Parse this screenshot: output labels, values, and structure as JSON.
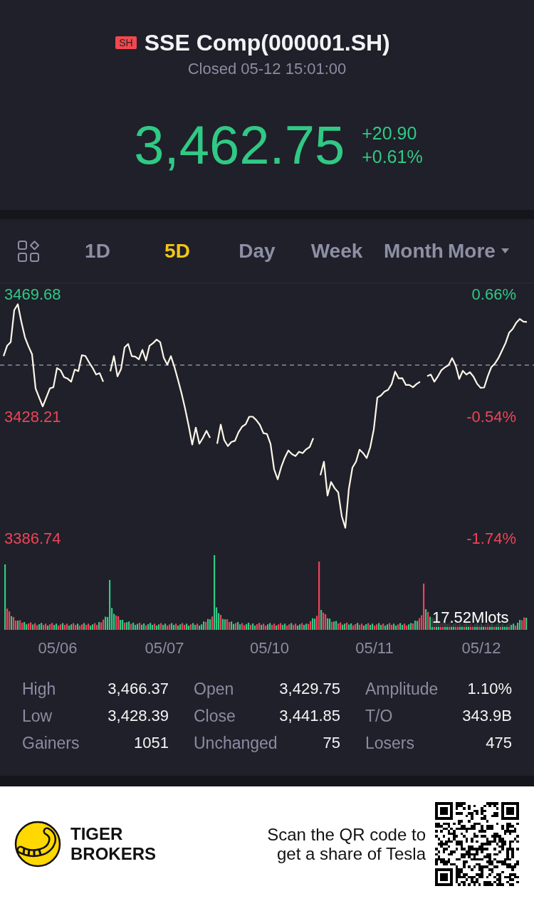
{
  "header": {
    "badge": "SH",
    "title": "SSE Comp(000001.SH)",
    "status": "Closed 05-12 15:01:00"
  },
  "quote": {
    "rising": true,
    "price": "3,462.75",
    "change": "+20.90",
    "change_percent": "+0.61%"
  },
  "tabs": [
    {
      "label": "1D",
      "selected": false,
      "kind": "period"
    },
    {
      "label": "5D",
      "selected": true,
      "kind": "period"
    },
    {
      "label": "Day",
      "selected": false,
      "kind": "period"
    },
    {
      "label": "Week",
      "selected": false,
      "kind": "period"
    },
    {
      "label": "Month",
      "selected": false,
      "kind": "period"
    },
    {
      "label": "More",
      "selected": false,
      "kind": "menu"
    }
  ],
  "price_chart": {
    "chart_data": {
      "type": "line",
      "ylim": [
        3263.4,
        3569.6
      ],
      "yticks": [
        {
          "value": 3469.68,
          "label": "3469.68"
        },
        {
          "value": 3428.21,
          "label": "3428.21"
        },
        {
          "value": 3386.74,
          "label": "3386.74"
        }
      ],
      "ref_lines": [
        {
          "axis": "y",
          "value": 3445.5
        }
      ],
      "values": [
        null,
        3448.6,
        3452.1,
        3453.3,
        3464.2,
        3466.2,
        3460.2,
        3455.0,
        3451.9,
        3449.2,
        3437.6,
        3434.5,
        3431.5,
        3434.5,
        3437.6,
        3438.0,
        3444.5,
        3443.8,
        3441.4,
        3440.9,
        3439.9,
        3444.0,
        3443.5,
        3448.9,
        3448.6,
        3446.5,
        3444.6,
        3442.3,
        3442.8,
        3439.9,
        null,
        3443.4,
        3448.6,
        3441.7,
        3444.2,
        3451.5,
        3452.7,
        3448.6,
        3448.4,
        3447.5,
        3450.7,
        3447.1,
        3452.1,
        3453.0,
        3454.2,
        3453.3,
        3448.0,
        3445.7,
        3448.6,
        3444.9,
        3440.5,
        3435.9,
        3430.7,
        3424.9,
        3418.5,
        3424.3,
        3418.8,
        3420.8,
        3423.2,
        3420.8,
        null,
        3418.8,
        3425.3,
        3420.0,
        3418.0,
        3419.4,
        3419.8,
        3422.7,
        3424.6,
        3425.4,
        3428.0,
        3428.0,
        3426.8,
        3425.2,
        3422.4,
        3422.1,
        3418.7,
        3410.1,
        3406.7,
        3410.9,
        3414.1,
        3416.5,
        3415.3,
        3414.6,
        3416.1,
        3415.6,
        3416.9,
        3417.7,
        3420.7,
        null,
        3408.1,
        3412.7,
        3401.2,
        3405.8,
        3403.7,
        3402.3,
        3394.2,
        3390.2,
        3403.5,
        3410.7,
        3412.7,
        3416.8,
        3415.6,
        3413.9,
        3417.6,
        3423.7,
        3434.5,
        3435.2,
        3436.5,
        3437.1,
        3439.1,
        3443.3,
        3441.0,
        3441.1,
        3438.8,
        3438.8,
        3438.0,
        3439.1,
        3439.9,
        null,
        3441.8,
        3442.3,
        3439.9,
        3441.7,
        3443.8,
        3444.8,
        3445.5,
        3447.9,
        3445.4,
        3440.8,
        3443.6,
        3442.3,
        3443.1,
        3441.6,
        3439.2,
        3437.8,
        3437.9,
        3441.7,
        3444.8,
        3446.0,
        3447.9,
        3450.4,
        3453.0,
        3456.5,
        3457.8,
        3459.9,
        3461.2,
        3460.3,
        3460.2,
        null,
        null
      ]
    },
    "percent_ticks": [
      "0.66%",
      "-0.54%",
      "-1.74%"
    ],
    "date_labels": [
      "05/06",
      "05/07",
      "05/10",
      "05/11",
      "05/12"
    ],
    "volume_label": "17.52Mlots"
  },
  "stats": [
    {
      "label": "High",
      "value": "3,466.37"
    },
    {
      "label": "Open",
      "value": "3,429.75"
    },
    {
      "label": "Amplitude",
      "value": "1.10%"
    },
    {
      "label": "Low",
      "value": "3,428.39"
    },
    {
      "label": "Close",
      "value": "3,441.85"
    },
    {
      "label": "T/O",
      "value": "343.9B"
    },
    {
      "label": "Gainers",
      "value": "1051"
    },
    {
      "label": "Unchanged",
      "value": "75"
    },
    {
      "label": "Losers",
      "value": "475"
    }
  ],
  "promo": {
    "brand": "TIGER BROKERS",
    "message": "Scan the QR code to get a share of Tesla"
  }
}
